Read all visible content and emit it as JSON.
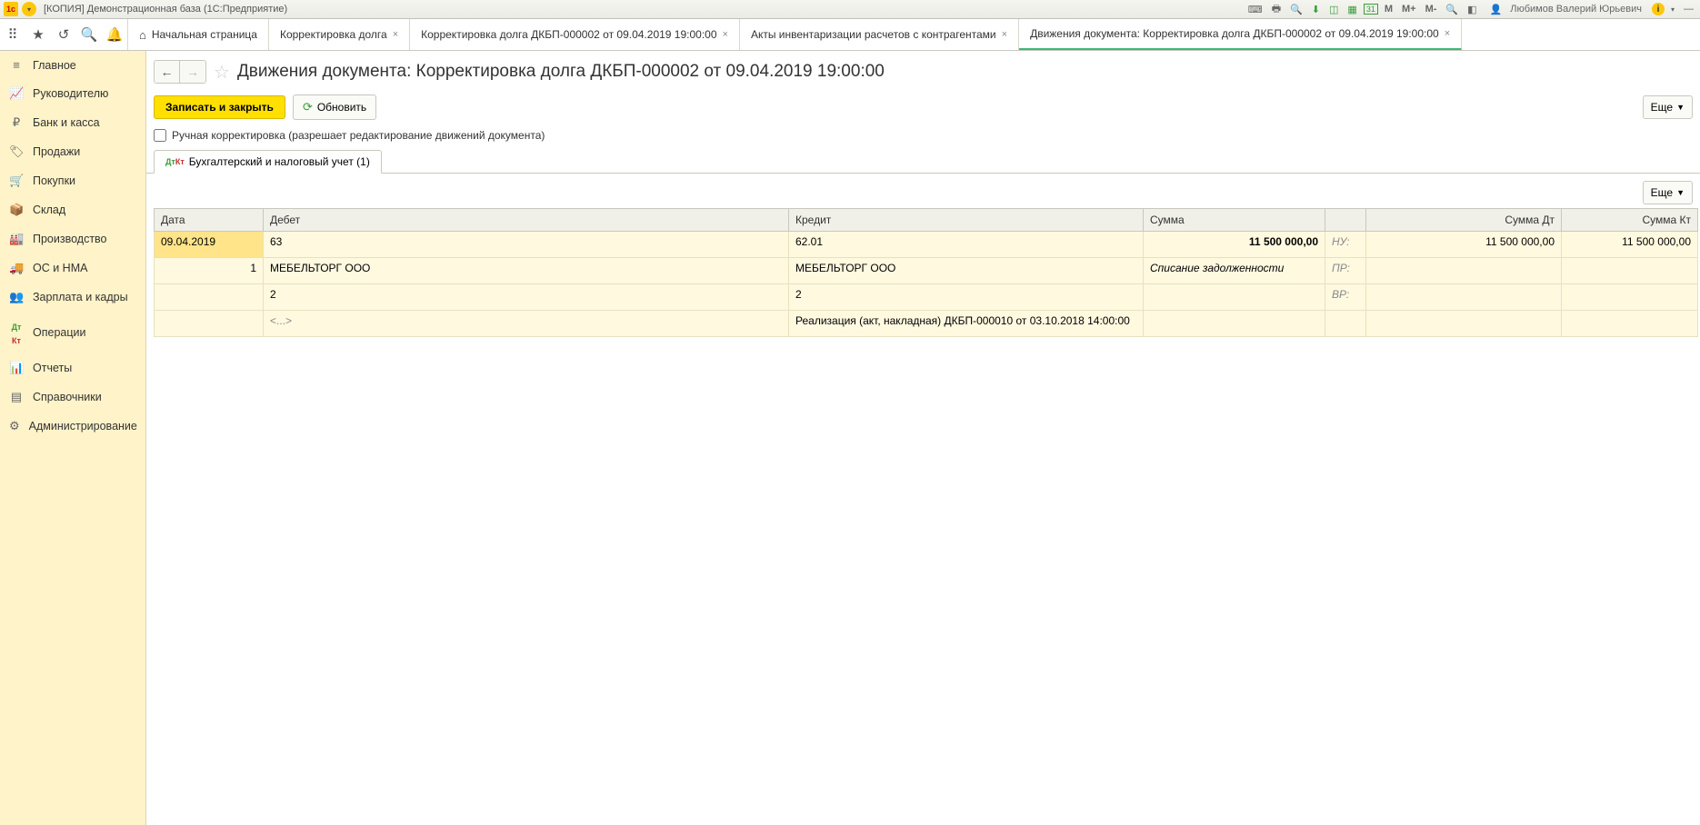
{
  "titlebar": {
    "title": "[КОПИЯ] Демонстрационная база  (1С:Предприятие)",
    "user": "Любимов Валерий Юрьевич",
    "m": "M",
    "mplus": "M+",
    "mminus": "M-"
  },
  "tabs": {
    "home": "Начальная страница",
    "t1": "Корректировка долга",
    "t2": "Корректировка долга ДКБП-000002 от 09.04.2019 19:00:00",
    "t3": "Акты инвентаризации расчетов с контрагентами",
    "t4": "Движения документа: Корректировка долга ДКБП-000002 от 09.04.2019 19:00:00"
  },
  "sidebar": {
    "main": "Главное",
    "manager": "Руководителю",
    "bank": "Банк и касса",
    "sales": "Продажи",
    "purchases": "Покупки",
    "warehouse": "Склад",
    "production": "Производство",
    "assets": "ОС и НМА",
    "salary": "Зарплата и кадры",
    "operations": "Операции",
    "reports": "Отчеты",
    "refs": "Справочники",
    "admin": "Администрирование"
  },
  "page": {
    "title": "Движения документа: Корректировка долга ДКБП-000002 от 09.04.2019 19:00:00",
    "save_close": "Записать и закрыть",
    "refresh": "Обновить",
    "more": "Еще",
    "manual_check": "Ручная корректировка (разрешает редактирование движений документа)",
    "inner_tab": "Бухгалтерский и налоговый учет (1)"
  },
  "grid": {
    "headers": {
      "date": "Дата",
      "debit": "Дебет",
      "credit": "Кредит",
      "sum": "Сумма",
      "sumdt": "Сумма Дт",
      "sumkt": "Сумма Кт"
    },
    "row": {
      "date": "09.04.2019",
      "num": "1",
      "debit_acc": "63",
      "credit_acc": "62.01",
      "sum": "11 500 000,00",
      "nu_label": "НУ:",
      "nu_dt": "11 500 000,00",
      "nu_kt": "11 500 000,00",
      "debit_party": "МЕБЕЛЬТОРГ ООО",
      "credit_party": "МЕБЕЛЬТОРГ ООО",
      "desc": "Списание задолженности",
      "pr_label": "ПР:",
      "debit_sub2": "2",
      "credit_sub2": "2",
      "vr_label": "ВР:",
      "debit_sub3": "<...>",
      "credit_doc": "Реализация (акт, накладная) ДКБП-000010 от 03.10.2018 14:00:00"
    }
  }
}
